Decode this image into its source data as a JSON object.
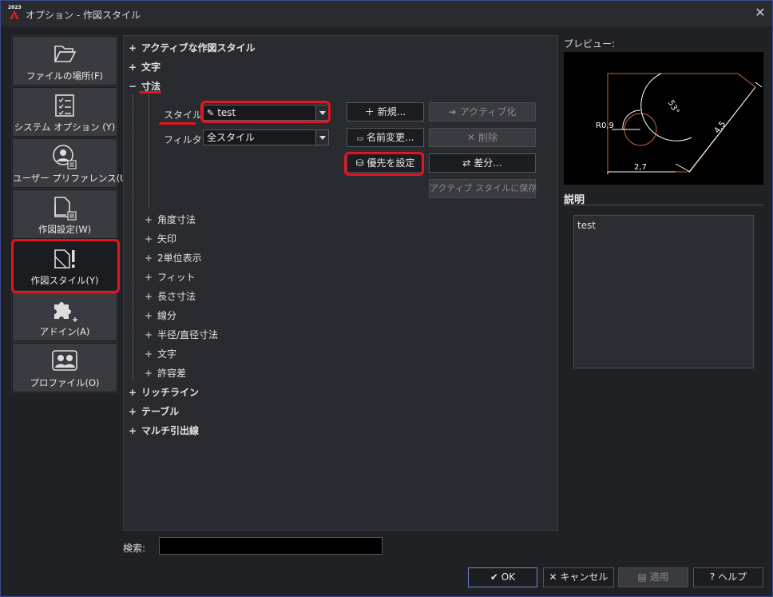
{
  "window": {
    "title": "オプション - 作図スタイル",
    "app_badge": "2023"
  },
  "sidebar": {
    "items": [
      {
        "label": "ファイルの場所(F)",
        "icon": "folder-icon"
      },
      {
        "label": "システム オプション (Y)",
        "icon": "checklist-icon"
      },
      {
        "label": "ユーザー プリファレンス(U)",
        "icon": "user-icon"
      },
      {
        "label": "作図設定(W)",
        "icon": "drawing-settings-icon"
      },
      {
        "label": "作図スタイル(Y)",
        "icon": "drawing-style-icon"
      },
      {
        "label": "アドイン(A)",
        "icon": "puzzle-icon"
      },
      {
        "label": "プロファイル(O)",
        "icon": "profile-icon"
      }
    ]
  },
  "tree": {
    "active_style": "アクティブな作図スタイル",
    "text": "文字",
    "dimension": "寸法",
    "style_label": "スタイル:",
    "style_value": "test",
    "filter_label": "フィルタ:",
    "filter_value": "全スタイル",
    "sub": [
      "角度寸法",
      "矢印",
      "2単位表示",
      "フィット",
      "長さ寸法",
      "線分",
      "半径/直径寸法",
      "文字",
      "許容差"
    ],
    "after": [
      "リッチライン",
      "テーブル",
      "マルチ引出線"
    ]
  },
  "buttons": {
    "new": "新規...",
    "activate": "アクティブ化",
    "rename": "名前変更...",
    "delete": "削除",
    "set_priority": "優先を設定",
    "diff": "差分...",
    "save_active": "アクティブ スタイルに保存"
  },
  "preview": {
    "label": "プレビュー:",
    "dims": {
      "radius": "R0,9",
      "angle": "53°",
      "diag": "4,5",
      "bottom": "2,7"
    }
  },
  "description": {
    "header": "説明",
    "text": "test"
  },
  "search": {
    "label": "検索:",
    "value": ""
  },
  "footer": {
    "ok": "OK",
    "cancel": "キャンセル",
    "apply": "適用",
    "help": "ヘルプ"
  },
  "colors": {
    "highlight": "#e6141e",
    "preview_outline": "#c06a40"
  }
}
